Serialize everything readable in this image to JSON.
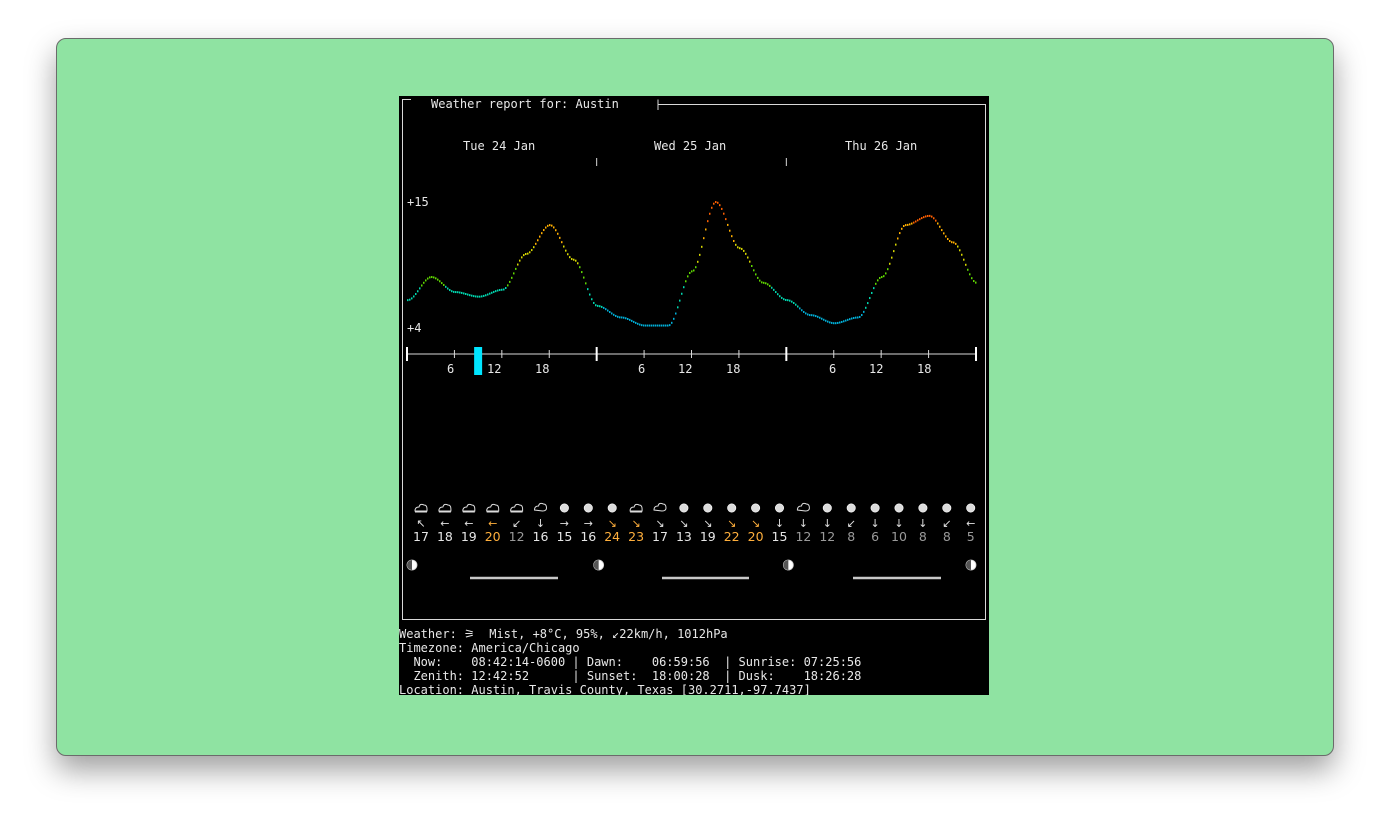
{
  "window_title": "",
  "report": {
    "title": "Weather report for: Austin",
    "days": [
      "Tue 24 Jan",
      "Wed 25 Jan",
      "Thu 26 Jan"
    ],
    "y_max_label": "+15",
    "y_min_label": "+4",
    "hour_ticks": [
      "6",
      "12",
      "18"
    ],
    "current_hour": 9
  },
  "forecast": {
    "conditions": [
      "partly-cloudy",
      "partly-cloudy",
      "partly-cloudy",
      "partly-cloudy",
      "partly-cloudy",
      "cloudy",
      "sunny",
      "sunny",
      "sunny",
      "partly-cloudy",
      "cloudy",
      "sunny",
      "sunny",
      "sunny",
      "sunny",
      "sunny",
      "cloudy",
      "sunny",
      "sunny",
      "sunny",
      "sunny",
      "sunny",
      "sunny",
      "sunny"
    ],
    "wind_arrows": [
      "↖",
      "←",
      "←",
      "←",
      "↙",
      "↓",
      "→",
      "→",
      "↘",
      "↘",
      "↘",
      "↘",
      "↘",
      "↘",
      "↘",
      "↓",
      "↓",
      "↓",
      "↙",
      "↓",
      "↓",
      "↓",
      "↙",
      "←"
    ],
    "wind_speeds": [
      "17",
      "18",
      "19",
      "20",
      "12",
      "16",
      "15",
      "16",
      "24",
      "23",
      "17",
      "13",
      "19",
      "22",
      "20",
      "15",
      "12",
      "12",
      "8",
      "6",
      "10",
      "8",
      "8",
      "5"
    ],
    "speed_colors": [
      "#e6e6e6",
      "#e6e6e6",
      "#e6e6e6",
      "#ffaf3c",
      "#9a9a9a",
      "#e6e6e6",
      "#e6e6e6",
      "#e6e6e6",
      "#ffaf3c",
      "#ffaf3c",
      "#e6e6e6",
      "#e6e6e6",
      "#e6e6e6",
      "#ffaf3c",
      "#ffaf3c",
      "#e6e6e6",
      "#9a9a9a",
      "#9a9a9a",
      "#9a9a9a",
      "#9a9a9a",
      "#9a9a9a",
      "#9a9a9a",
      "#9a9a9a",
      "#9a9a9a"
    ]
  },
  "chart_data": {
    "type": "line",
    "title": "",
    "xlabel": "",
    "ylabel": "",
    "ylim": [
      4,
      15
    ],
    "x_unit": "hour since Tue 24 Jan 00:00",
    "x": [
      0,
      3,
      6,
      9,
      12,
      15,
      18,
      21,
      24,
      27,
      30,
      33,
      36,
      39,
      42,
      45,
      48,
      51,
      54,
      57,
      60,
      63,
      66,
      69,
      72
    ],
    "values": [
      6.5,
      8.5,
      7.2,
      6.8,
      7.4,
      10.5,
      13.0,
      10.0,
      6.0,
      5.0,
      4.3,
      4.3,
      9.0,
      15.0,
      11.0,
      8.0,
      6.5,
      5.2,
      4.5,
      5.0,
      8.5,
      13.0,
      13.8,
      11.5,
      8.0
    ],
    "grid": false,
    "color_scale": [
      "#00afd7",
      "#00d7af",
      "#5fd700",
      "#d7d700",
      "#ffaf00",
      "#ff5f00"
    ]
  },
  "status": {
    "weather": "Weather: ⚞  Mist, +8°C, 95%, ↙22km/h, 1012hPa",
    "timezone": "Timezone: America/Chicago",
    "now_line": "  Now:    08:42:14-0600 | Dawn:    06:59:56  | Sunrise: 07:25:56",
    "zenith_line": "  Zenith: 12:42:52      | Sunset:  18:00:28  | Dusk:    18:26:28",
    "location": "Location: Austin, Travis County, Texas [30.2711,-97.7437]"
  },
  "colors": {
    "window_bg": "#8fe3a2",
    "terminal_bg": "#000000",
    "now_marker": "#00e5ff",
    "warm_speed": "#ffaf3c",
    "dim_speed": "#9a9a9a"
  }
}
